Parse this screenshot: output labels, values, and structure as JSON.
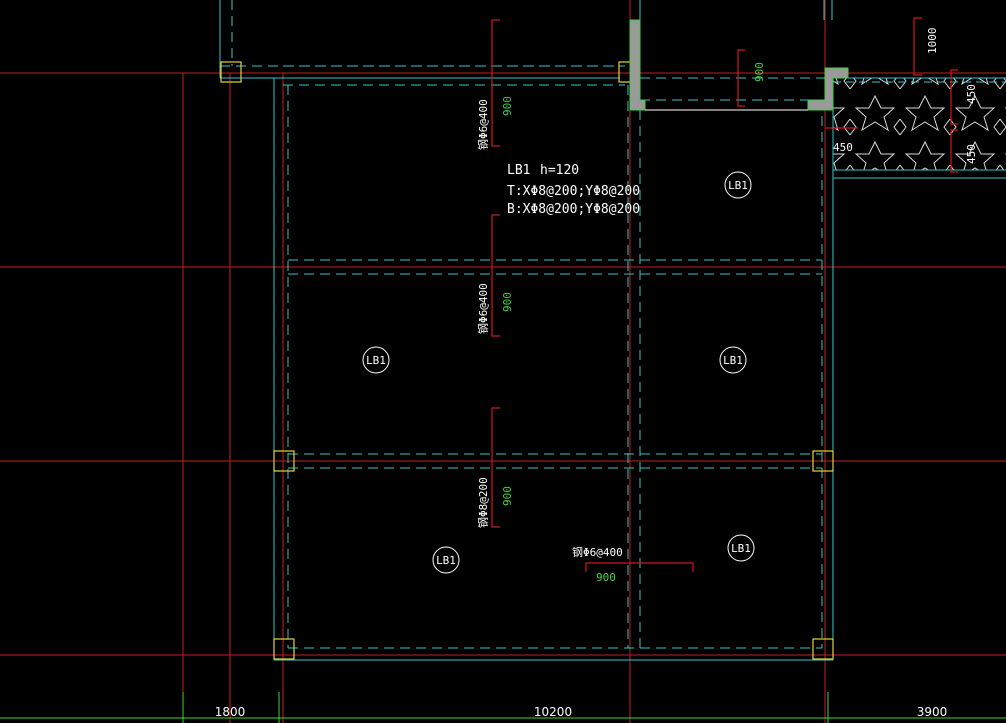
{
  "colors": {
    "background": "#000000",
    "axis_line": "#c0201f",
    "beam_cyan": "#35c6c6",
    "column_yellow": "#e6d33a",
    "rebar_red": "#d01818",
    "dim_green": "#3fd33f",
    "text_white": "#ffffff",
    "hatch_white": "#d8d8d8",
    "wall_fill": "#9a9a9a",
    "wall_green": "#3fd33f"
  },
  "slab_note": {
    "name": "LB1",
    "thickness": "h=120",
    "top_rebar": "T:XΦ8@200;YΦ8@200",
    "bottom_rebar": "B:XΦ8@200;YΦ8@200"
  },
  "slab_tags": [
    "LB1",
    "LB1",
    "LB1",
    "LB1",
    "LB1"
  ],
  "support_rebars": [
    {
      "spec": "钢Φ6@400",
      "length": "900"
    },
    {
      "spec": "钢Φ6@400",
      "length": "900"
    },
    {
      "spec": "钢Φ8@200",
      "length": "900"
    },
    {
      "spec": "钢Φ6@400",
      "length": "900"
    }
  ],
  "top_right_dims": [
    "900",
    "1000",
    "450",
    "450",
    "450"
  ],
  "bottom_dimensions": [
    "1800",
    "10200",
    "3900"
  ]
}
